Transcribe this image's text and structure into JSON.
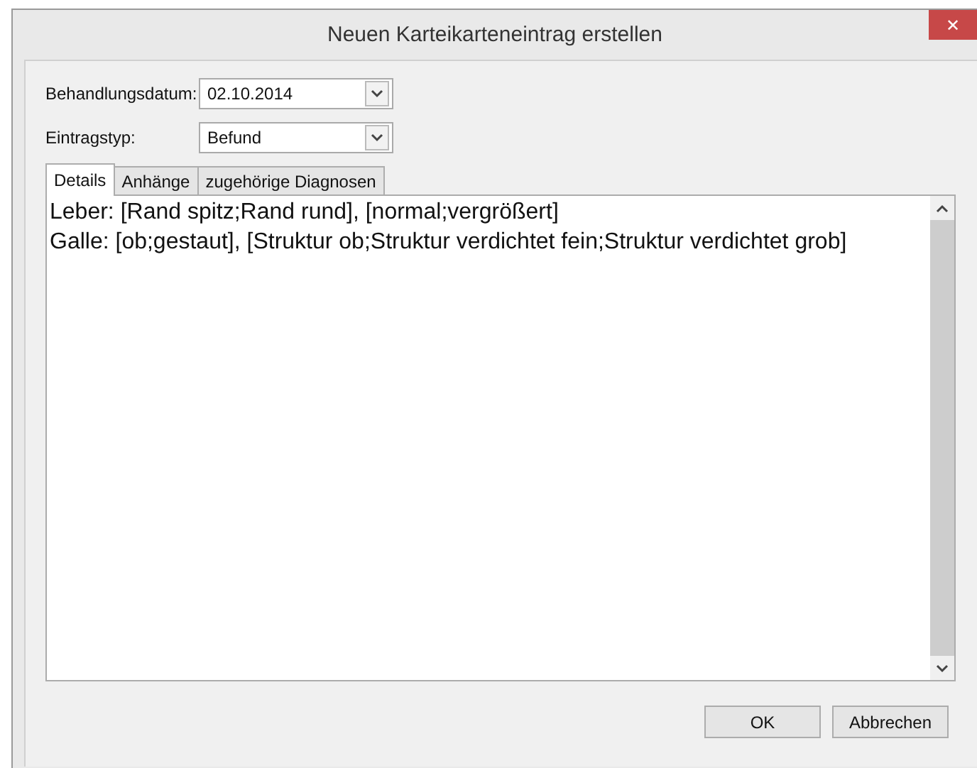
{
  "window": {
    "title": "Neuen Karteikarteneintrag erstellen",
    "close": "✕"
  },
  "fields": [
    {
      "label": "Behandlungsdatum:",
      "value": "02.10.2014"
    },
    {
      "label": "Eintragstyp:",
      "value": "Befund"
    }
  ],
  "tabs": [
    {
      "label": "Details",
      "selected": true
    },
    {
      "label": "Anhänge",
      "selected": false
    },
    {
      "label": "zugehörige Diagnosen",
      "selected": false
    }
  ],
  "details": {
    "lines": [
      "Leber: [Rand spitz;Rand rund], [normal;vergrößert]",
      "Galle: [ob;gestaut], [Struktur ob;Struktur verdichtet fein;Struktur verdichtet grob]"
    ]
  },
  "buttons": [
    "OK",
    "Abbrechen"
  ]
}
